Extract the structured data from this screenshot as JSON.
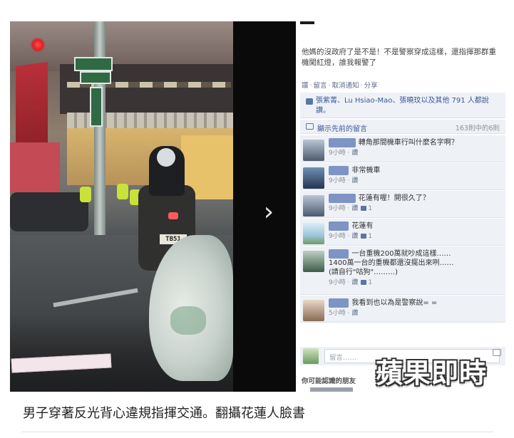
{
  "post": {
    "status_text": "他媽的沒政府了是不是！不是警察穿成這樣，還指揮那群重機闖紅燈，誰我報警了",
    "actions": {
      "like": "讚",
      "comment": "留言",
      "notify": "取消通知",
      "share": "分享"
    },
    "likes_text": "張紫菁、Lu Hsiao-Mao、張曉玟以及其他 791 人都說讚。",
    "previous_comments_label": "顯示先前的留言",
    "comment_count": "163則中的6則",
    "comments": [
      {
        "text": "轉角那間機車行叫什麼名字啊？",
        "time": "9小時",
        "like_label": "讚",
        "likes": ""
      },
      {
        "text": "非常機車",
        "time": "9小時",
        "like_label": "讚",
        "likes": ""
      },
      {
        "text": "花蓮有喔！開很久了？",
        "time": "9小時",
        "like_label": "讚",
        "likes": "1"
      },
      {
        "text": "花蓮有",
        "time": "9小時",
        "like_label": "讚",
        "likes": "1"
      },
      {
        "text": "一台重機200萬就吵成這樣……\n1400萬一台的重機都還沒擺出來咧……\n(請自行\"咕狗\"………)",
        "time": "9小時",
        "like_label": "讚",
        "likes": "1"
      },
      {
        "text": "我看到也以為是警察說= =",
        "time": "5小時",
        "like_label": "讚",
        "likes": ""
      }
    ],
    "reply_placeholder": "留言……",
    "people_you_may_know": "你可能認識的朋友"
  },
  "photo": {
    "plate_text": "TB51"
  },
  "watermark": "蘋果即時",
  "caption": "男子穿著反光背心違規指揮交通。翻攝花蓮人臉書",
  "colors": {
    "fb_link": "#3b5998",
    "fb_bg": "#eef1f6"
  }
}
